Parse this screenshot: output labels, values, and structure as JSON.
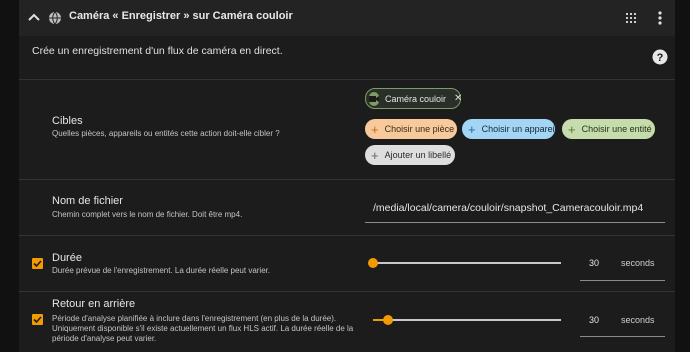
{
  "header": {
    "title": "Caméra « Enregistrer » sur Caméra couloir"
  },
  "description": "Crée un enregistrement d'un flux de caméra en direct.",
  "targets": {
    "title": "Cibles",
    "subtitle": "Quelles pièces, appareils ou entités cette action doit-elle cibler ?",
    "selected_chip": "Caméra couloir",
    "buttons": {
      "area": "Choisir une pièce",
      "device": "Choisir un appareil",
      "entity": "Choisir une entité",
      "label": "Ajouter un libellé"
    }
  },
  "filename": {
    "title": "Nom de fichier",
    "subtitle": "Chemin complet vers le nom de fichier. Doit être mp4.",
    "value": "/media/local/camera/couloir/snapshot_Cameracouloir.mp4"
  },
  "duration": {
    "title": "Durée",
    "subtitle": "Durée prévue de l'enregistrement. La durée réelle peut varier.",
    "checked": true,
    "value": "30",
    "unit": "seconds",
    "slider_fraction": 0.0
  },
  "lookback": {
    "title": "Retour en arrière",
    "subtitle_lines": [
      "Période d'analyse planifiée à inclure dans l'enregistrement (en plus de la durée).",
      "Uniquement disponible s'il existe actuellement un flux HLS actif. La durée réelle de la",
      "période d'analyse peut varier."
    ],
    "checked": true,
    "value": "30",
    "unit": "seconds",
    "slider_fraction": 0.08
  },
  "colors": {
    "accent": "#f29b00"
  }
}
